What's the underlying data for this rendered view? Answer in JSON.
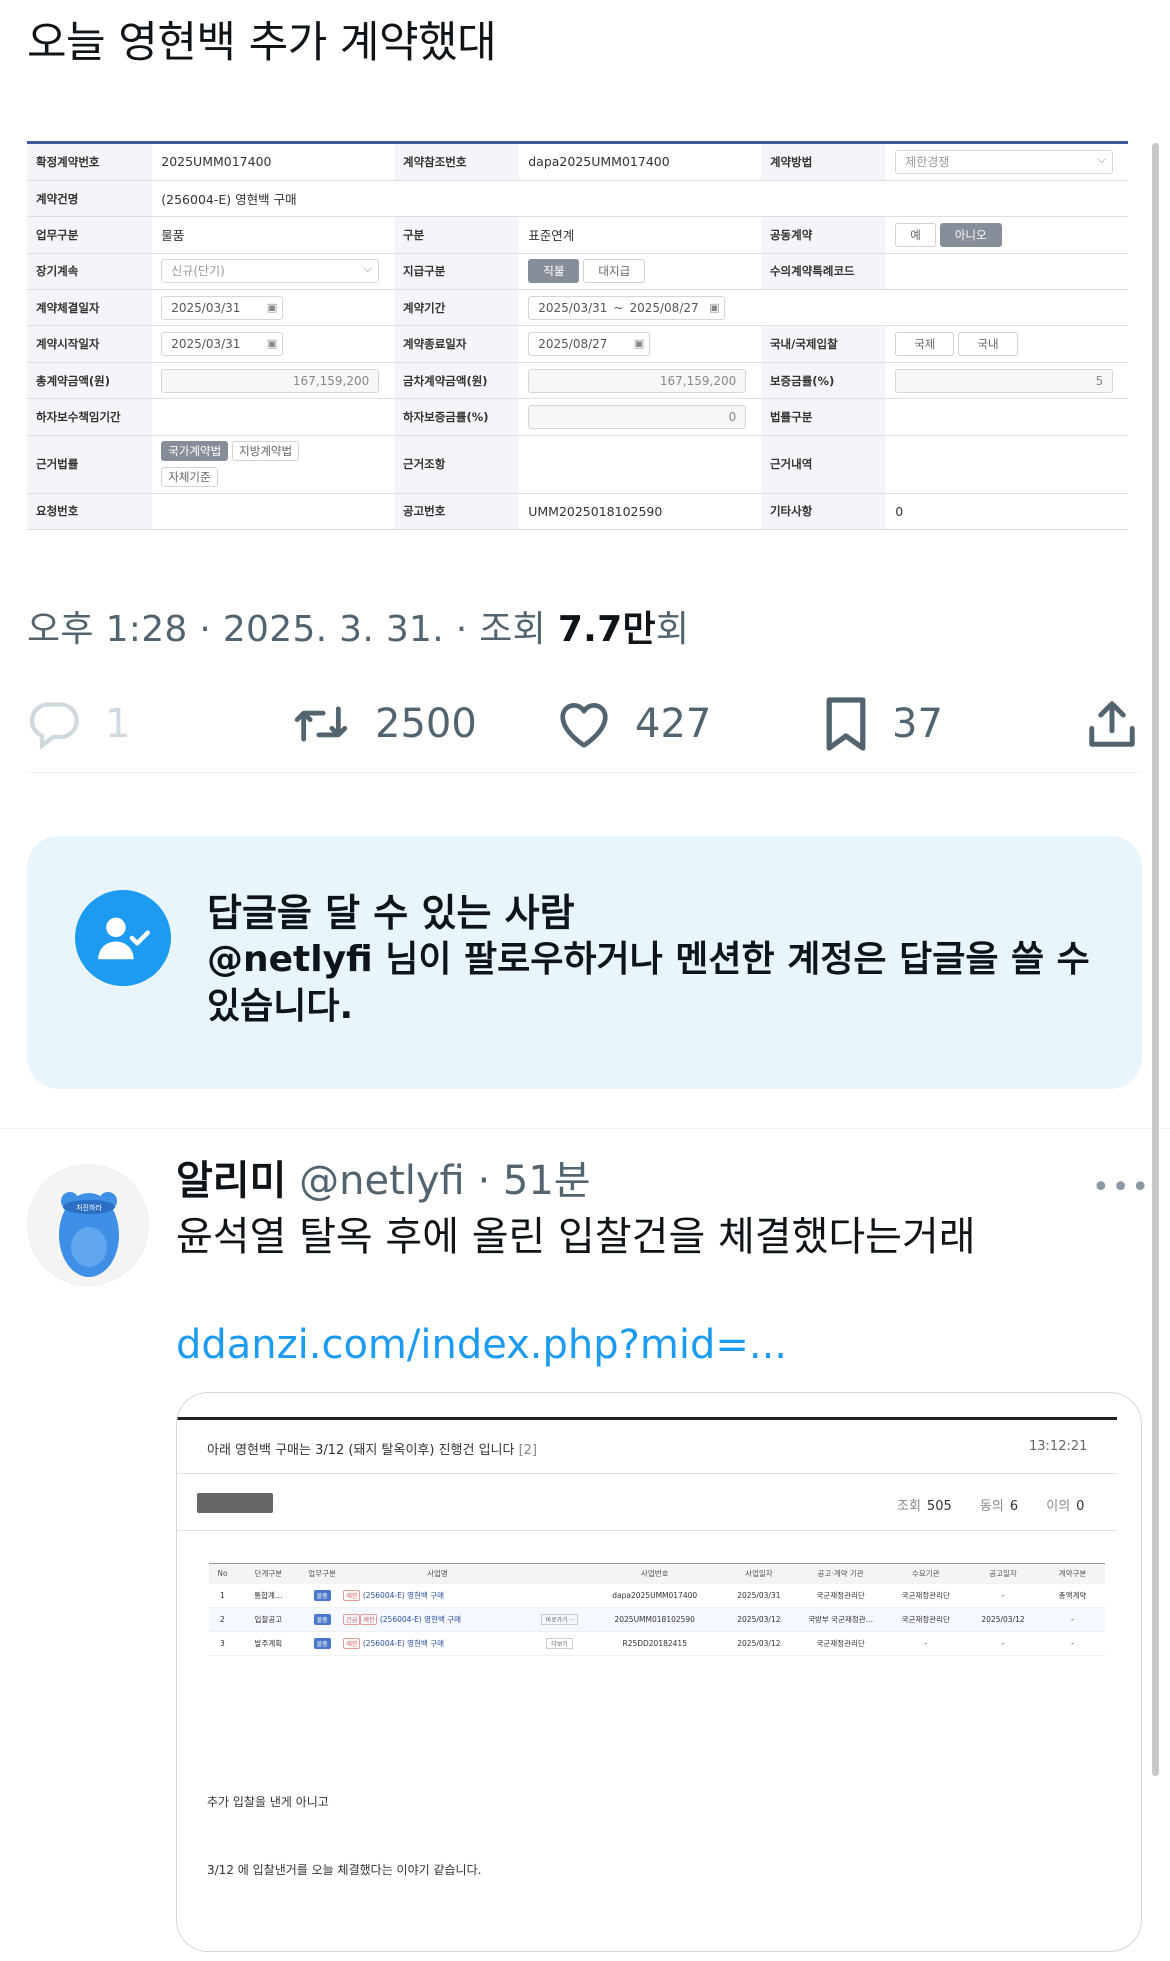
{
  "tweet": {
    "text": "오늘 영현백 추가 계약했대",
    "meta_time": "오후 1:28 · 2025. 3. 31. · 조회 ",
    "meta_views": "7.7만",
    "meta_suffix": "회"
  },
  "contract": {
    "rows": [
      {
        "l1": "확정계약번호",
        "v1": "2025UMM017400",
        "l2": "계약참조번호",
        "v2": "dapa2025UMM017400",
        "l3": "계약방법",
        "v3": "제한경쟁"
      },
      {
        "l1": "계약건명",
        "v1": "(256004-E) 영현백 구매"
      },
      {
        "l1": "업무구분",
        "v1": "물품",
        "l2": "구분",
        "v2": "표준연계",
        "l3": "공동계약",
        "b1": "예",
        "b2": "아니오"
      },
      {
        "l1": "장기계속",
        "v1": "신규(단기)",
        "l2": "지급구분",
        "b1": "직불",
        "b2": "대지급",
        "l3": "수의계약특례코드"
      },
      {
        "l1": "계약체결일자",
        "v1": "2025/03/31",
        "l2": "계약기간",
        "v2a": "2025/03/31",
        "tilde": "~",
        "v2b": "2025/08/27"
      },
      {
        "l1": "계약시작일자",
        "v1": "2025/03/31",
        "l2": "계약종료일자",
        "v2": "2025/08/27",
        "l3": "국내/국제입찰",
        "b1": "국제",
        "b2": "국내"
      },
      {
        "l1": "총계약금액(원)",
        "v1": "167,159,200",
        "l2": "금차계약금액(원)",
        "v2": "167,159,200",
        "l3": "보증금률(%)",
        "v3": "5"
      },
      {
        "l1": "하자보수책임기간",
        "l2": "하자보증금률(%)",
        "v2": "0",
        "l3": "법률구분"
      },
      {
        "l1": "근거법률",
        "b1": "국가계약법",
        "b2": "지방계약법",
        "b3": "자체기준",
        "l2": "근거조항",
        "l3": "근거내역"
      },
      {
        "l1": "요청번호",
        "l2": "공고번호",
        "v2": "UMM2025018102590",
        "l3": "기타사항",
        "v3": "0"
      }
    ]
  },
  "actions": {
    "reply_count": "1",
    "retweet_count": "2500",
    "like_count": "427",
    "bookmark_count": "37"
  },
  "banner": {
    "title": "답글을 달 수 있는 사람",
    "body": "@netlyfi 님이 팔로우하거나 멘션한 계정은 답글을 쓸 수 있습니다."
  },
  "reply": {
    "name": "알리미",
    "handle": "@netlyfi · 51분",
    "more": "•••",
    "text": "윤석열 탈옥 후에 올린 입찰건을 체결했다는거래",
    "link": "ddanzi.com/index.php?mid=...",
    "avatar_label": "처진하라"
  },
  "card": {
    "title": "아래 영현백 구매는 3/12 (돼지 탈옥이후) 진행건 입니다",
    "comments": "[2]",
    "time": "13:12:21",
    "views_label": "조회",
    "views": "505",
    "agree_label": "동의",
    "agree": "6",
    "disagree_label": "이의",
    "disagree": "0",
    "headers": [
      "No",
      "단계구분",
      "업무구분",
      "사업명",
      "",
      "사업번호",
      "사업일자",
      "공고·계약 기관",
      "수요기관",
      "공고일자",
      "계약구분"
    ],
    "rows": [
      {
        "no": "1",
        "stage": "통합계…",
        "type": "물품",
        "prefix": "제한",
        "name": "(256004-E) 영현백 구매",
        "btn": "",
        "num": "dapa2025UMM017400",
        "date": "2025/03/31",
        "org": "국군재정관리단",
        "demand": "국군재정관리단",
        "pub": "-",
        "kind": "총액계약"
      },
      {
        "no": "2",
        "stage": "입찰공고",
        "type": "물품",
        "prefix2": "긴급",
        "prefix": "제한",
        "name": "(256004-E) 영현백 구매",
        "btn": "바로가기 ··",
        "num": "2025UMM018102590",
        "date": "2025/03/12",
        "org": "국방부 국군재정관…",
        "demand": "국군재정관리단",
        "pub": "2025/03/12",
        "kind": "-"
      },
      {
        "no": "3",
        "stage": "발주계획",
        "type": "물품",
        "prefix": "제한",
        "name": "(256004-E) 영현백 구매",
        "btn": "더보기",
        "num": "R25DD20182415",
        "date": "2025/03/12",
        "org": "국군재정관리단",
        "demand": "-",
        "pub": "-",
        "kind": "-"
      }
    ],
    "para1": "추가 입찰을 낸게 아니고",
    "para2": "3/12 에 입찰낸거를 오늘 체결했다는 이야기 같습니다."
  },
  "colors": {
    "accent": "#1d9bf0",
    "banner_bg": "#e8f5fd",
    "muted_text": "#536471"
  },
  "icons": [
    "reply-icon",
    "retweet-icon",
    "like-icon",
    "bookmark-icon",
    "share-icon",
    "person-check-icon",
    "more-icon"
  ]
}
